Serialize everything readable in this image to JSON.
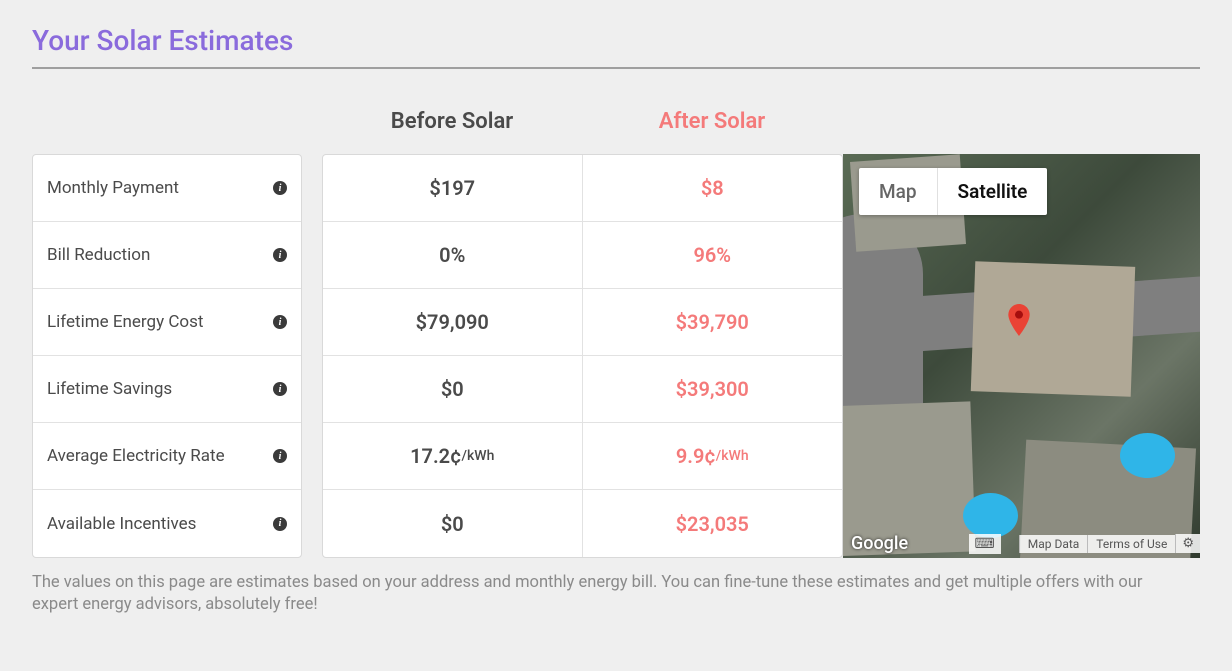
{
  "title": "Your Solar Estimates",
  "columns": {
    "before": "Before Solar",
    "after": "After Solar"
  },
  "rows": [
    {
      "label": "Monthly Payment",
      "before": "$197",
      "after": "$8",
      "unit_before": "",
      "unit_after": ""
    },
    {
      "label": "Bill Reduction",
      "before": "0%",
      "after": "96%",
      "unit_before": "",
      "unit_after": ""
    },
    {
      "label": "Lifetime Energy Cost",
      "before": "$79,090",
      "after": "$39,790",
      "unit_before": "",
      "unit_after": ""
    },
    {
      "label": "Lifetime Savings",
      "before": "$0",
      "after": "$39,300",
      "unit_before": "",
      "unit_after": ""
    },
    {
      "label": "Average Electricity Rate",
      "before": "17.2¢",
      "after": "9.9¢",
      "unit_before": "/kWh",
      "unit_after": "/kWh"
    },
    {
      "label": "Available Incentives",
      "before": "$0",
      "after": "$23,035",
      "unit_before": "",
      "unit_after": ""
    }
  ],
  "map": {
    "type_options": {
      "map": "Map",
      "satellite": "Satellite"
    },
    "active_type": "satellite",
    "provider": "Google",
    "controls": {
      "data": "Map Data",
      "terms": "Terms of Use"
    }
  },
  "disclaimer": "The values on this page are estimates based on your address and monthly energy bill. You can fine-tune these estimates and get multiple offers with our expert energy advisors, absolutely free!"
}
